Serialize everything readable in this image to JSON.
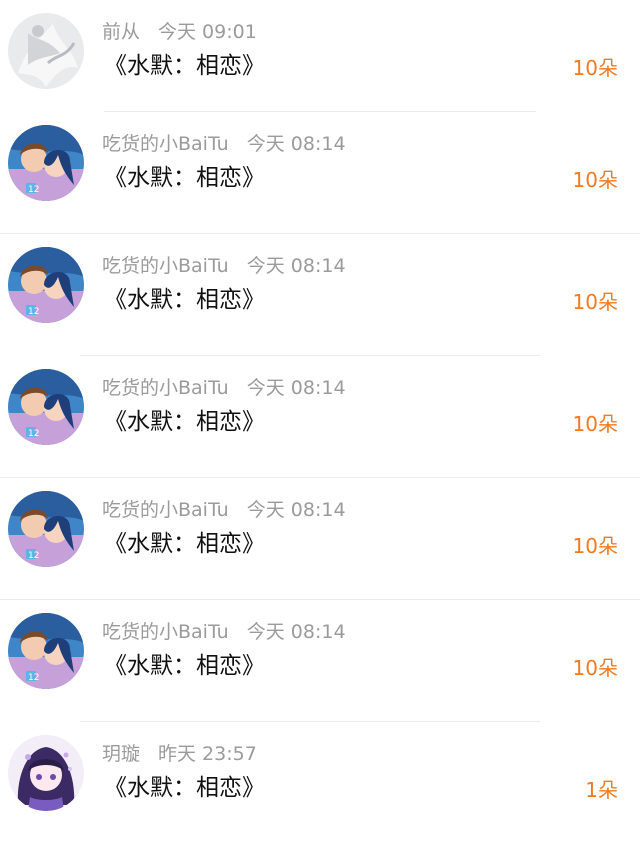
{
  "gifts": [
    {
      "user": "前从",
      "time": "今天 09:01",
      "title": "《水默：相恋》",
      "count": "10朵",
      "avatar": "avatar-white-flower"
    },
    {
      "user": "吃货的小BaiTu",
      "time": "今天 08:14",
      "title": "《水默：相恋》",
      "count": "10朵",
      "avatar": "avatar-anime-couple"
    },
    {
      "user": "吃货的小BaiTu",
      "time": "今天 08:14",
      "title": "《水默：相恋》",
      "count": "10朵",
      "avatar": "avatar-anime-couple"
    },
    {
      "user": "吃货的小BaiTu",
      "time": "今天 08:14",
      "title": "《水默：相恋》",
      "count": "10朵",
      "avatar": "avatar-anime-couple"
    },
    {
      "user": "吃货的小BaiTu",
      "time": "今天 08:14",
      "title": "《水默：相恋》",
      "count": "10朵",
      "avatar": "avatar-anime-couple"
    },
    {
      "user": "吃货的小BaiTu",
      "time": "今天 08:14",
      "title": "《水默：相恋》",
      "count": "10朵",
      "avatar": "avatar-anime-couple"
    },
    {
      "user": "玥璇",
      "time": "昨天 23:57",
      "title": "《水默：相恋》",
      "count": "1朵",
      "avatar": "avatar-purple-girl"
    }
  ],
  "colors": {
    "count": "#f07a22",
    "meta": "#9b9b9b",
    "title": "#111111",
    "divider": "#ececec"
  }
}
